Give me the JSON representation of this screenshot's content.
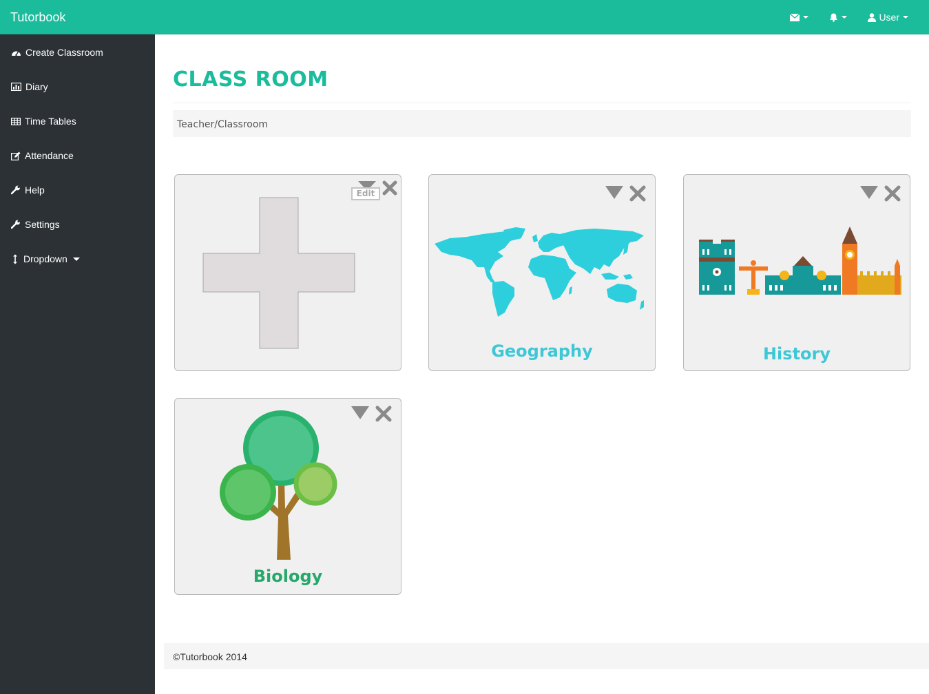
{
  "app": {
    "brand": "Tutorbook"
  },
  "topnav": {
    "mail_icon": "envelope-icon",
    "bell_icon": "bell-icon",
    "user_label": "User"
  },
  "sidebar": {
    "items": [
      {
        "label": "Create Classroom",
        "icon": "dashboard-icon"
      },
      {
        "label": "Diary",
        "icon": "bar-chart-icon"
      },
      {
        "label": "Time Tables",
        "icon": "table-icon"
      },
      {
        "label": "Attendance",
        "icon": "edit-icon"
      },
      {
        "label": "Help",
        "icon": "wrench-icon"
      },
      {
        "label": "Settings",
        "icon": "wrench-icon"
      },
      {
        "label": "Dropdown",
        "icon": "vertical-arrows-icon"
      }
    ]
  },
  "main": {
    "title": "CLASS ROOM",
    "breadcrumb": "Teacher/Classroom",
    "cards": [
      {
        "label": "",
        "edit_label": "Edit",
        "icon": "plus-icon"
      },
      {
        "label": "Geography",
        "icon": "world-map-icon",
        "color": "#3ec7d6"
      },
      {
        "label": "History",
        "icon": "city-skyline-icon",
        "color": "#3ec7d6"
      },
      {
        "label": "Biology",
        "icon": "tree-icon",
        "color": "#27a86b"
      }
    ]
  },
  "footer": {
    "text": "©Tutorbook 2014"
  },
  "colors": {
    "accent": "#1abc9c",
    "sidebar": "#2b3134",
    "control_gray": "#8a8a8a"
  }
}
